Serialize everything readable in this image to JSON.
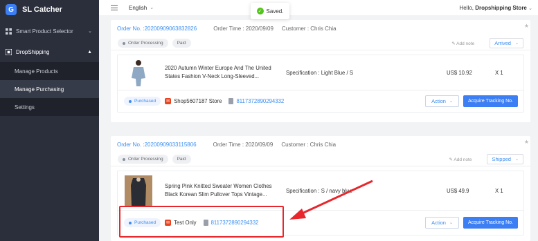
{
  "app": {
    "name": "SL Catcher",
    "logo_glyph": "G"
  },
  "sidebar": {
    "groups": [
      {
        "label": "Smart Product Selector",
        "icon": "grid-icon"
      },
      {
        "label": "DropShipping",
        "icon": "cart-icon"
      }
    ],
    "subitems": [
      {
        "label": "Manage Products"
      },
      {
        "label": "Manage Purchasing",
        "active": true
      },
      {
        "label": "Settings"
      }
    ]
  },
  "topbar": {
    "language": "English",
    "greeting": "Hello,",
    "store": "Dropshipping Store"
  },
  "toast": {
    "message": "Saved."
  },
  "orders": [
    {
      "order_no": "Order No. :20200909063832826",
      "order_time": "Order Time : 2020/09/09",
      "customer": "Customer : Chris Chia",
      "tags": [
        "Order Processing",
        "Paid"
      ],
      "add_note": "Add note",
      "status": "Arrived",
      "item": {
        "title": "2020 Autumn Winter Europe And The United States Fashion V-Neck Long-Sleeved...",
        "spec": "Specification : Light Blue / S",
        "price": "US$ 10.92",
        "qty": "X 1"
      },
      "purchase_tag": "Purchased",
      "store": "Shop5607187 Store",
      "tracking": "8117372890294332",
      "action_label": "Action",
      "acquire_label": "Acquire Tracking No."
    },
    {
      "order_no": "Order No. :20200909033115806",
      "order_time": "Order Time : 2020/09/09",
      "customer": "Customer : Chris Chia",
      "tags": [
        "Order Processing",
        "Paid"
      ],
      "add_note": "Add note",
      "status": "Shipped",
      "item": {
        "title": "Spring Pink Knitted Sweater Women Clothes Black Korean Slim Pullover Tops Vintage...",
        "spec": "Specification : S / navy blue",
        "price": "US$ 49.9",
        "qty": "X 1"
      },
      "purchase_tag": "Purchased",
      "store": "Test Only",
      "tracking": "8117372890294332",
      "action_label": "Action",
      "acquire_label": "Acquire Tracking No."
    }
  ],
  "colors": {
    "accent": "#3c7ef3",
    "sidebar_bg": "#2b2f3c",
    "annotation": "#e8262b",
    "success": "#52c41a"
  }
}
